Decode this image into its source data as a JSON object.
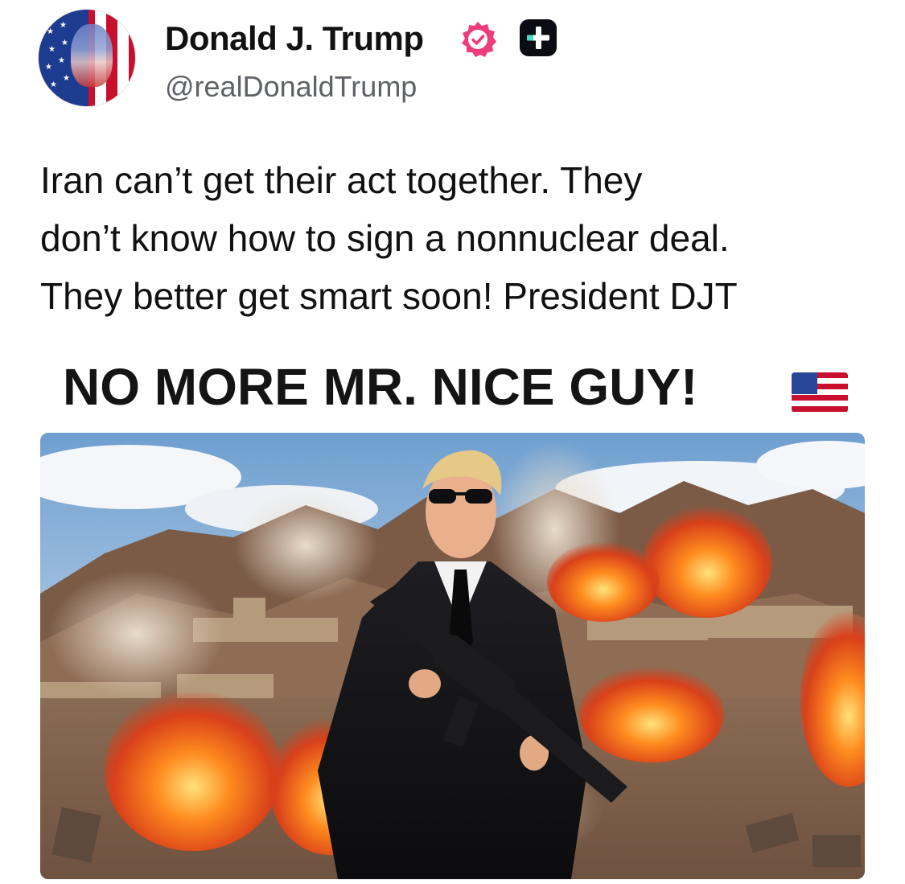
{
  "author": {
    "name": "Donald J. Trump",
    "handle": "@realDonaldTrump",
    "verified_badge_color": "#ee3d7d",
    "plus_badge_color": "#0b0b14"
  },
  "post": {
    "lines": [
      "Iran can’t get their act together. They",
      "don’t know how to sign a nonnuclear deal.",
      "They better get smart soon! President DJT"
    ]
  },
  "media": {
    "headline": "NO MORE MR. NICE GUY!",
    "headline_emoji": "flag-us-emoji"
  },
  "colors": {
    "text": "#111111",
    "handle": "#5f6168",
    "background": "#ffffff"
  }
}
